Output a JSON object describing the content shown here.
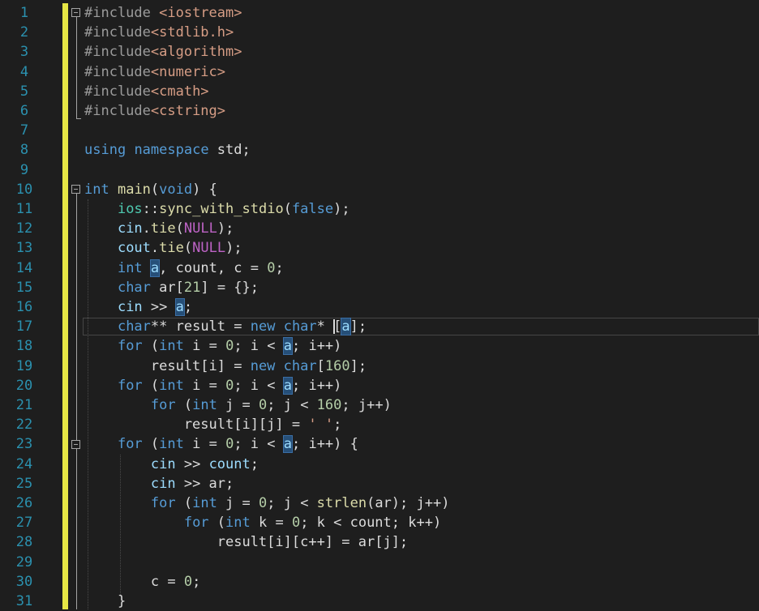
{
  "gutter": {
    "line_numbers": [
      "1",
      "2",
      "3",
      "4",
      "5",
      "6",
      "7",
      "8",
      "9",
      "10",
      "11",
      "12",
      "13",
      "14",
      "15",
      "16",
      "17",
      "18",
      "19",
      "20",
      "21",
      "22",
      "23",
      "24",
      "25",
      "26",
      "27",
      "28",
      "29",
      "30",
      "31"
    ]
  },
  "code": {
    "lines": [
      [
        [
          "pp",
          "#include "
        ],
        [
          "inc",
          "<iostream>"
        ]
      ],
      [
        [
          "pp",
          "#include"
        ],
        [
          "inc",
          "<stdlib.h>"
        ]
      ],
      [
        [
          "pp",
          "#include"
        ],
        [
          "inc",
          "<algorithm>"
        ]
      ],
      [
        [
          "pp",
          "#include"
        ],
        [
          "inc",
          "<numeric>"
        ]
      ],
      [
        [
          "pp",
          "#include"
        ],
        [
          "inc",
          "<cmath>"
        ]
      ],
      [
        [
          "pp",
          "#include"
        ],
        [
          "inc",
          "<cstring>"
        ]
      ],
      [],
      [
        [
          "kw",
          "using"
        ],
        [
          "pl",
          " "
        ],
        [
          "kw",
          "namespace"
        ],
        [
          "pl",
          " std;"
        ]
      ],
      [],
      [
        [
          "kw",
          "int"
        ],
        [
          "pl",
          " "
        ],
        [
          "fn",
          "main"
        ],
        [
          "pl",
          "("
        ],
        [
          "kw",
          "void"
        ],
        [
          "pl",
          ") {"
        ]
      ],
      [
        [
          "pl",
          "    "
        ],
        [
          "ty",
          "ios"
        ],
        [
          "pl",
          "::"
        ],
        [
          "fn",
          "sync_with_stdio"
        ],
        [
          "pl",
          "("
        ],
        [
          "kw",
          "false"
        ],
        [
          "pl",
          ");"
        ]
      ],
      [
        [
          "pl",
          "    "
        ],
        [
          "var",
          "cin"
        ],
        [
          "pl",
          "."
        ],
        [
          "fn",
          "tie"
        ],
        [
          "pl",
          "("
        ],
        [
          "mac",
          "NULL"
        ],
        [
          "pl",
          ");"
        ]
      ],
      [
        [
          "pl",
          "    "
        ],
        [
          "var",
          "cout"
        ],
        [
          "pl",
          "."
        ],
        [
          "fn",
          "tie"
        ],
        [
          "pl",
          "("
        ],
        [
          "mac",
          "NULL"
        ],
        [
          "pl",
          ");"
        ]
      ],
      [
        [
          "pl",
          "    "
        ],
        [
          "kw",
          "int"
        ],
        [
          "pl",
          " "
        ],
        [
          "hl",
          "a"
        ],
        [
          "pl",
          ", count, c = "
        ],
        [
          "num",
          "0"
        ],
        [
          "pl",
          ";"
        ]
      ],
      [
        [
          "pl",
          "    "
        ],
        [
          "kw",
          "char"
        ],
        [
          "pl",
          " ar["
        ],
        [
          "num",
          "21"
        ],
        [
          "pl",
          "] = {};"
        ]
      ],
      [
        [
          "pl",
          "    "
        ],
        [
          "var",
          "cin"
        ],
        [
          "pl",
          " >> "
        ],
        [
          "hl",
          "a"
        ],
        [
          "pl",
          ";"
        ]
      ],
      [
        [
          "pl",
          "    "
        ],
        [
          "kw",
          "char"
        ],
        [
          "pl",
          "** result = "
        ],
        [
          "kw",
          "new"
        ],
        [
          "pl",
          " "
        ],
        [
          "kw",
          "char"
        ],
        [
          "pl",
          "* ["
        ],
        [
          "hl",
          "a"
        ],
        [
          "pl",
          "];"
        ]
      ],
      [
        [
          "pl",
          "    "
        ],
        [
          "kw",
          "for"
        ],
        [
          "pl",
          " ("
        ],
        [
          "kw",
          "int"
        ],
        [
          "pl",
          " i = "
        ],
        [
          "num",
          "0"
        ],
        [
          "pl",
          "; i < "
        ],
        [
          "hl",
          "a"
        ],
        [
          "pl",
          "; i++)"
        ]
      ],
      [
        [
          "pl",
          "        result[i] = "
        ],
        [
          "kw",
          "new"
        ],
        [
          "pl",
          " "
        ],
        [
          "kw",
          "char"
        ],
        [
          "pl",
          "["
        ],
        [
          "num",
          "160"
        ],
        [
          "pl",
          "];"
        ]
      ],
      [
        [
          "pl",
          "    "
        ],
        [
          "kw",
          "for"
        ],
        [
          "pl",
          " ("
        ],
        [
          "kw",
          "int"
        ],
        [
          "pl",
          " i = "
        ],
        [
          "num",
          "0"
        ],
        [
          "pl",
          "; i < "
        ],
        [
          "hl",
          "a"
        ],
        [
          "pl",
          "; i++)"
        ]
      ],
      [
        [
          "pl",
          "        "
        ],
        [
          "kw",
          "for"
        ],
        [
          "pl",
          " ("
        ],
        [
          "kw",
          "int"
        ],
        [
          "pl",
          " j = "
        ],
        [
          "num",
          "0"
        ],
        [
          "pl",
          "; j < "
        ],
        [
          "num",
          "160"
        ],
        [
          "pl",
          "; j++)"
        ]
      ],
      [
        [
          "pl",
          "            result[i][j] = "
        ],
        [
          "str",
          "' '"
        ],
        [
          "pl",
          ";"
        ]
      ],
      [
        [
          "pl",
          "    "
        ],
        [
          "kw",
          "for"
        ],
        [
          "pl",
          " ("
        ],
        [
          "kw",
          "int"
        ],
        [
          "pl",
          " i = "
        ],
        [
          "num",
          "0"
        ],
        [
          "pl",
          "; i < "
        ],
        [
          "hl",
          "a"
        ],
        [
          "pl",
          "; i++) {"
        ]
      ],
      [
        [
          "pl",
          "        "
        ],
        [
          "var",
          "cin"
        ],
        [
          "pl",
          " >> "
        ],
        [
          "var",
          "count"
        ],
        [
          "pl",
          ";"
        ]
      ],
      [
        [
          "pl",
          "        "
        ],
        [
          "var",
          "cin"
        ],
        [
          "pl",
          " >> ar;"
        ]
      ],
      [
        [
          "pl",
          "        "
        ],
        [
          "kw",
          "for"
        ],
        [
          "pl",
          " ("
        ],
        [
          "kw",
          "int"
        ],
        [
          "pl",
          " j = "
        ],
        [
          "num",
          "0"
        ],
        [
          "pl",
          "; j < "
        ],
        [
          "fn",
          "strlen"
        ],
        [
          "pl",
          "(ar); j++)"
        ]
      ],
      [
        [
          "pl",
          "            "
        ],
        [
          "kw",
          "for"
        ],
        [
          "pl",
          " ("
        ],
        [
          "kw",
          "int"
        ],
        [
          "pl",
          " k = "
        ],
        [
          "num",
          "0"
        ],
        [
          "pl",
          "; k < count; k++)"
        ]
      ],
      [
        [
          "pl",
          "                result[i][c++] = ar[j];"
        ]
      ],
      [],
      [
        [
          "pl",
          "        c = "
        ],
        [
          "num",
          "0"
        ],
        [
          "pl",
          ";"
        ]
      ],
      [
        [
          "pl",
          "    }"
        ]
      ]
    ]
  },
  "colors": {
    "background": "#1e1e1e",
    "line_number": "#2b91af",
    "keyword": "#569cd6",
    "function": "#dcdcaa",
    "include_path": "#d69d85",
    "change_bar": "#e6e645"
  },
  "icons": {
    "fold_toggle": "collapse-box-icon"
  }
}
